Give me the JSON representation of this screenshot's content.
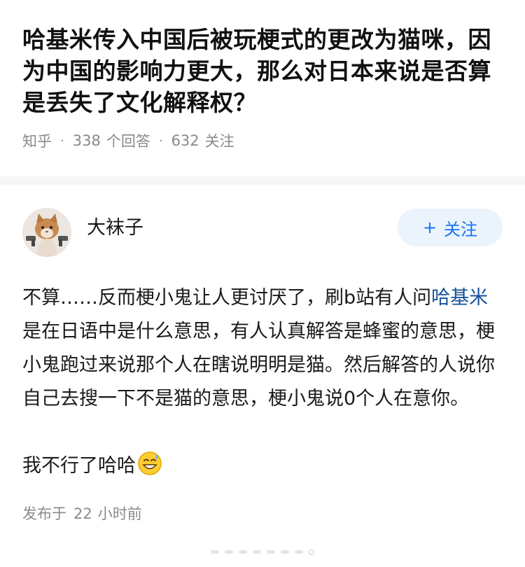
{
  "question": {
    "title": "哈基米传入中国后被玩梗式的更改为猫咪，因为中国的影响力更大，那么对日本来说是否算是丢失了文化解释权？",
    "source": "知乎",
    "answers_count": "338",
    "answers_label": "个回答",
    "followers_count": "632",
    "followers_label": "关注"
  },
  "answer": {
    "author_name": "大袜子",
    "avatar_icon": "cat-photo-avatar",
    "follow_button": "+ 关注",
    "follow_plus": "+",
    "follow_label": "关注",
    "content_before_link": "不算……反而梗小鬼让人更讨厌了，刷b站有人问",
    "link_text": "哈基米",
    "content_after_link": "是在日语中是什么意思，有人认真解答是蜂蜜的意思，梗小鬼跑过来说那个人在瞎说明明是猫。然后解答的人说你自己去搜一下不是猫的意思，梗小鬼说0个人在意你。",
    "content_second": "我不行了哈哈",
    "emoji_icon": "sweat-smile-emoji-icon",
    "posted_label": "发布于",
    "posted_number": "22",
    "posted_unit": "小时前"
  },
  "colors": {
    "accent": "#1772f6",
    "link": "#175199",
    "meta": "#8a8a8a",
    "follow_bg": "#ebf3fc",
    "divider": "#f6f6f6"
  }
}
